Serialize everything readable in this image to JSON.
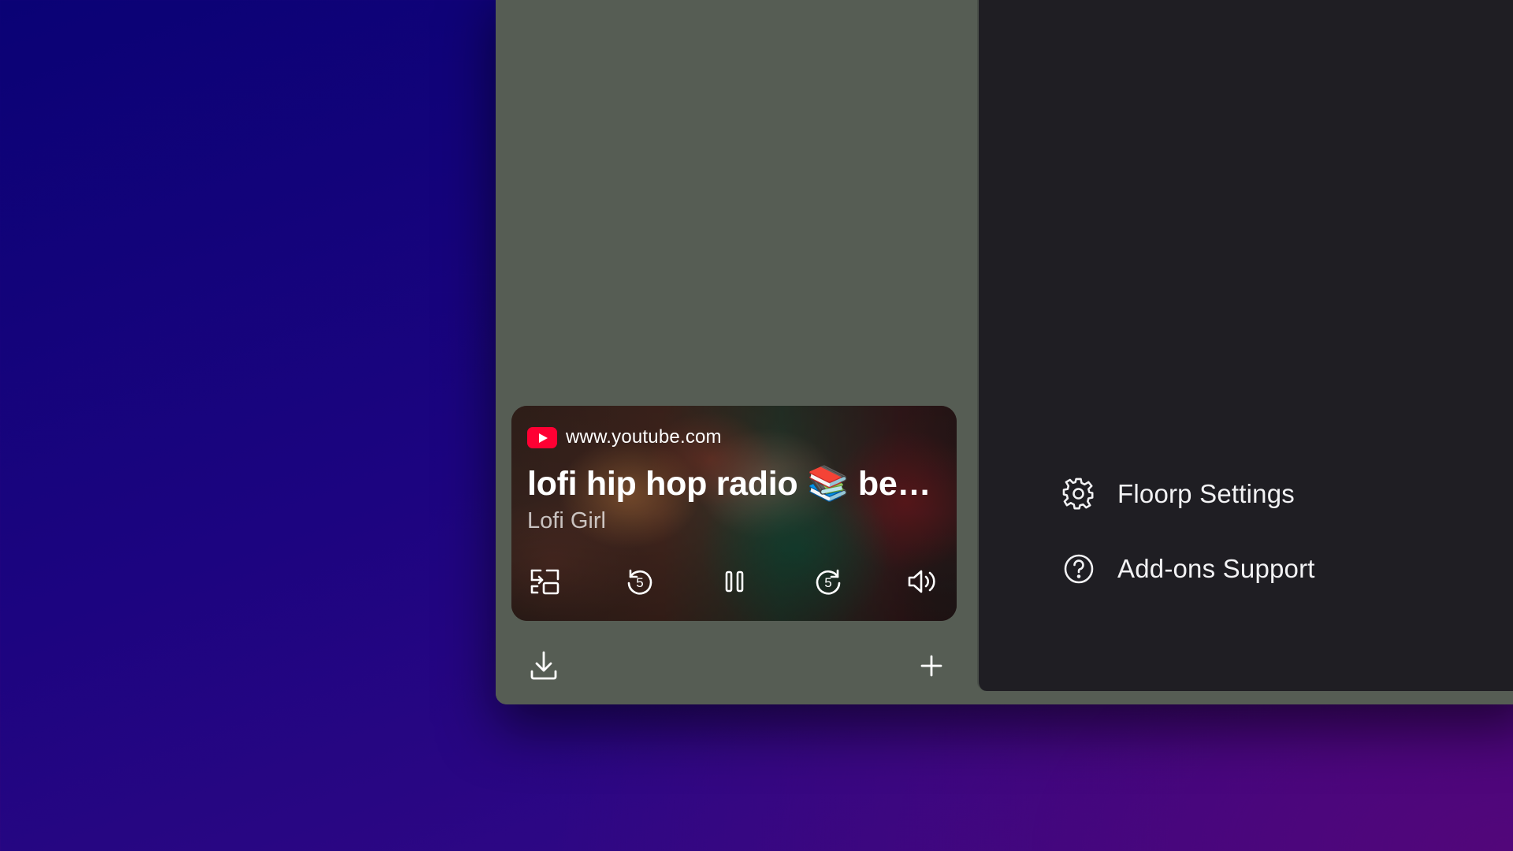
{
  "media": {
    "source_icon": "youtube-icon",
    "domain": "www.youtube.com",
    "title": "lofi hip hop radio 📚 be…",
    "artist": "Lofi Girl",
    "controls": [
      {
        "icon": "picture-in-picture-icon"
      },
      {
        "icon": "rewind-5-icon",
        "label": "5"
      },
      {
        "icon": "pause-icon"
      },
      {
        "icon": "forward-5-icon",
        "label": "5"
      },
      {
        "icon": "volume-icon"
      }
    ]
  },
  "sidebar_bottom": {
    "left_icon": "download-icon",
    "right_icon": "plus-icon"
  },
  "menu": {
    "items": [
      {
        "label": "Floorp Settings",
        "icon": "gear-icon"
      },
      {
        "label": "Add-ons Support",
        "icon": "help-circle-icon"
      }
    ]
  },
  "colors": {
    "sidebar_bg": "#565d54",
    "panel_bg": "#1f1e23",
    "youtube_red": "#ff0033",
    "desktop_top": "#0a0275",
    "desktop_bottom_right": "#52067a"
  }
}
